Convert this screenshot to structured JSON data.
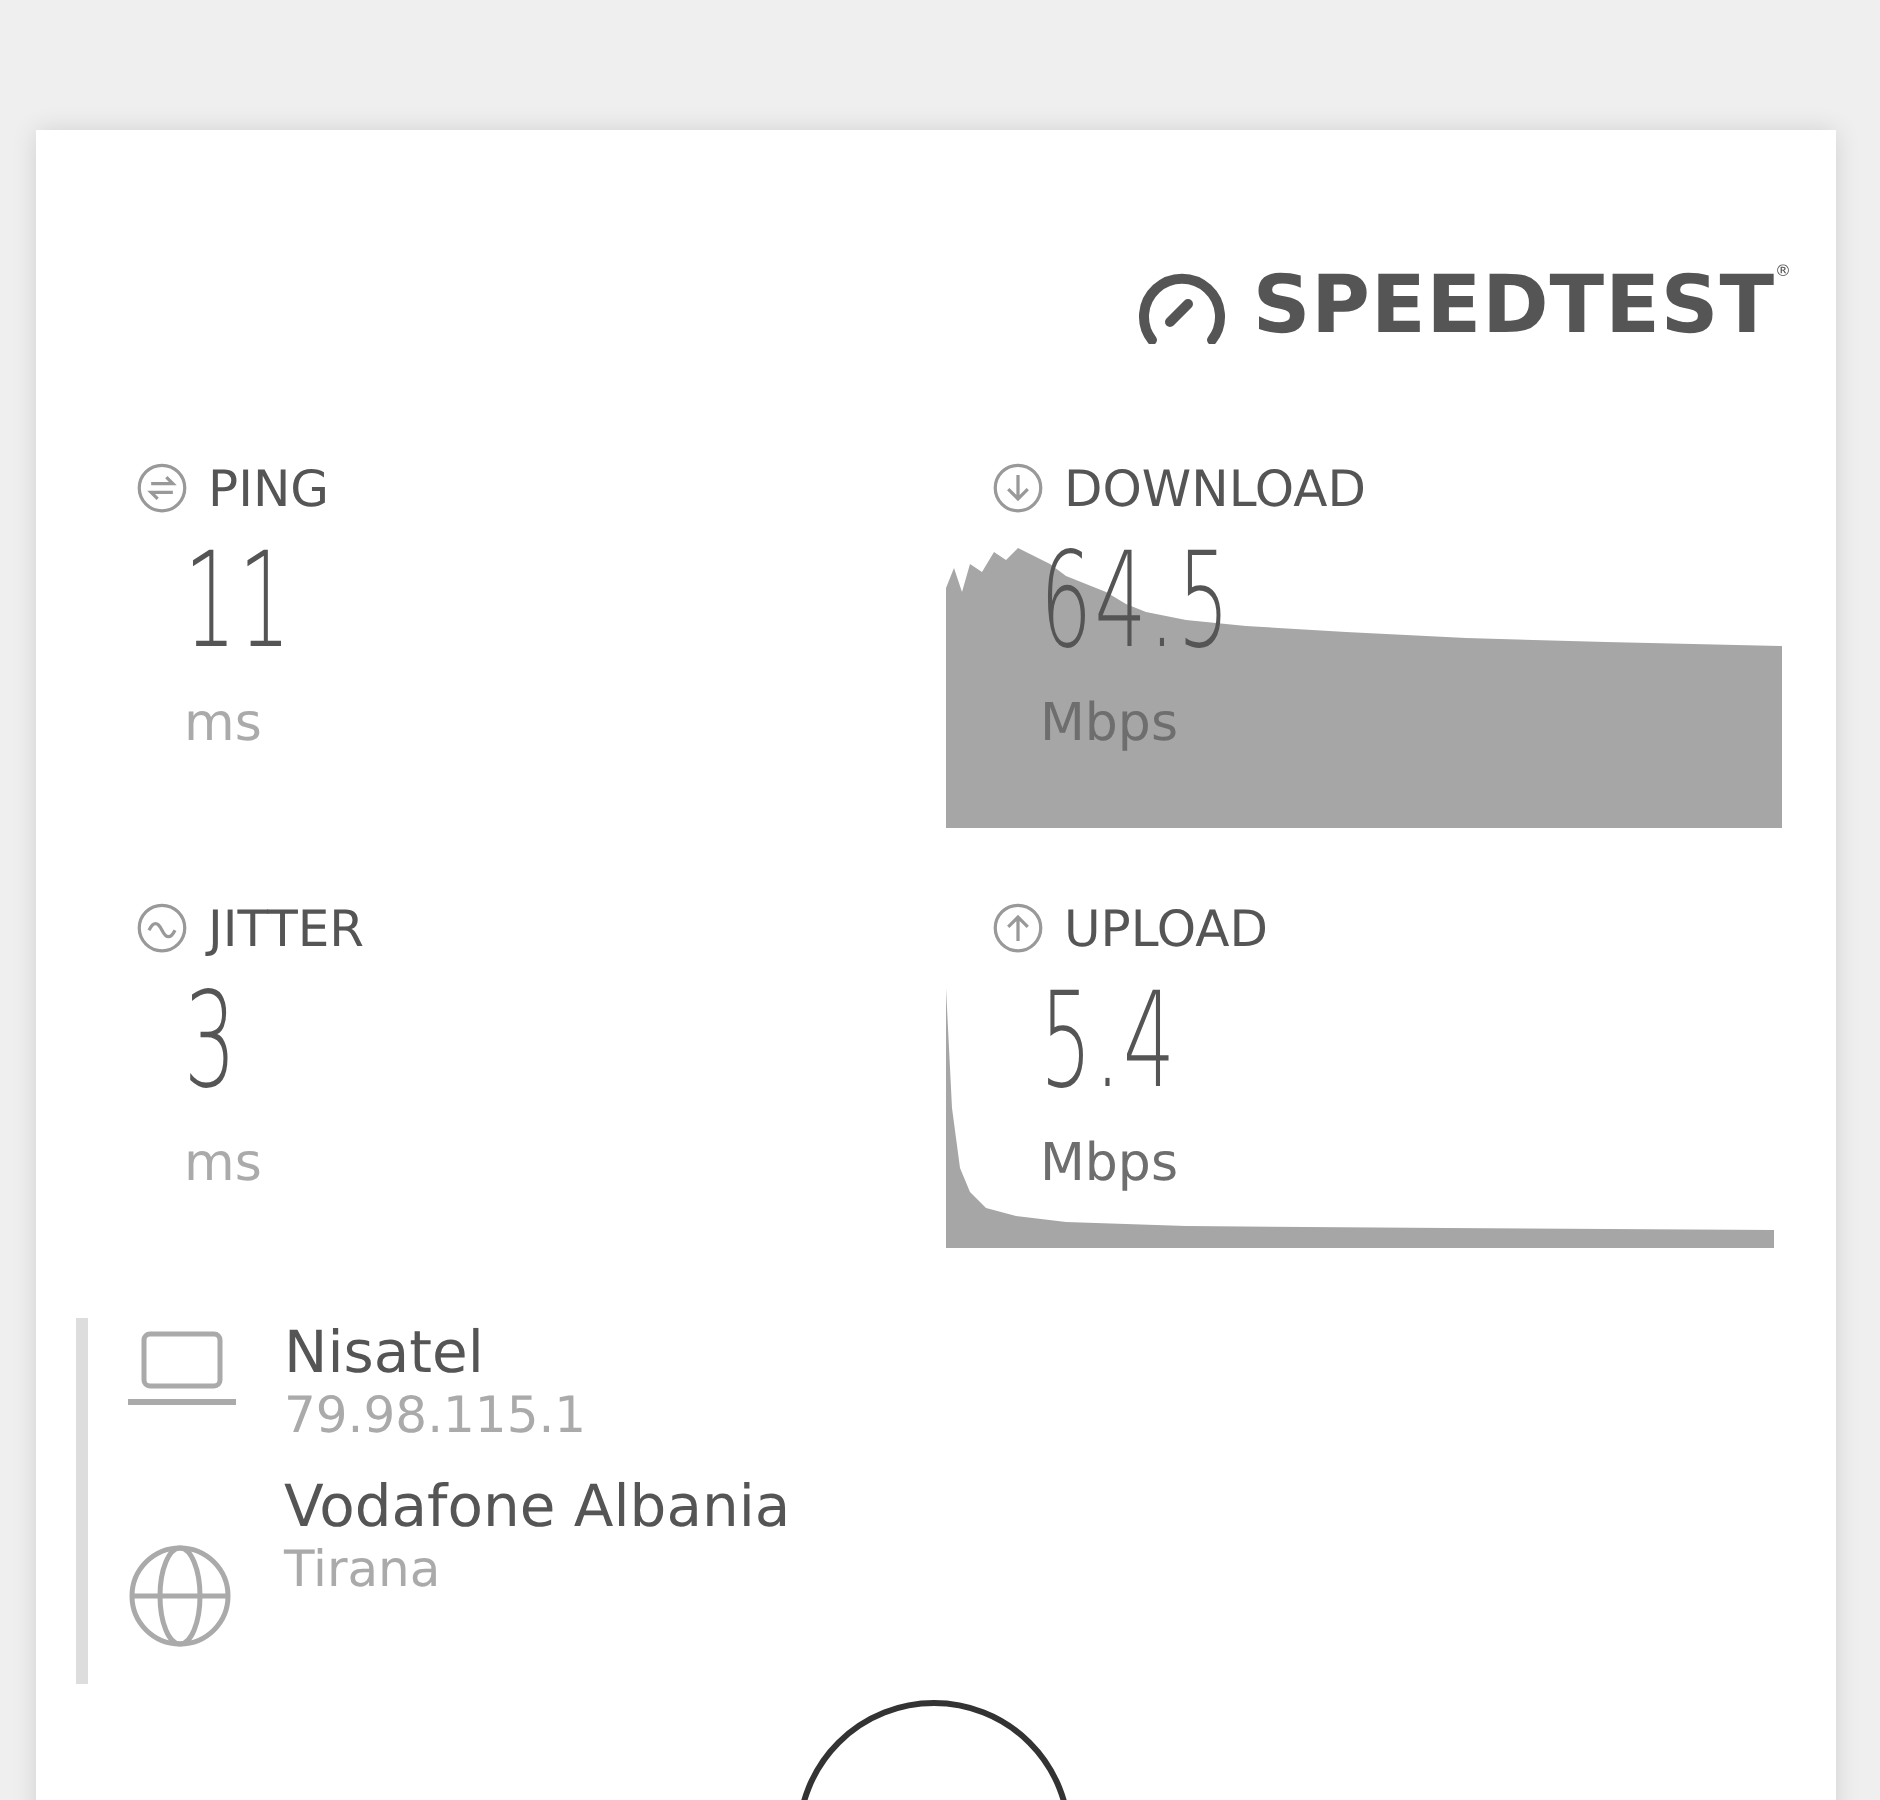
{
  "logo": {
    "text": "SPEEDTEST",
    "mark": "®"
  },
  "metrics": [
    {
      "kind": "ping",
      "label": "PING",
      "value": "11",
      "unit": "ms"
    },
    {
      "kind": "download",
      "label": "DOWNLOAD",
      "value": "64.5",
      "unit": "Mbps"
    },
    {
      "kind": "jitter",
      "label": "JITTER",
      "value": "3",
      "unit": "ms"
    },
    {
      "kind": "upload",
      "label": "UPLOAD",
      "value": "5.4",
      "unit": "Mbps"
    }
  ],
  "connections": [
    {
      "kind": "host",
      "name": "Nisatel",
      "detail": "79.98.115.1"
    },
    {
      "kind": "server",
      "name": "Vodafone Albania",
      "detail": "Tirana"
    }
  ]
}
